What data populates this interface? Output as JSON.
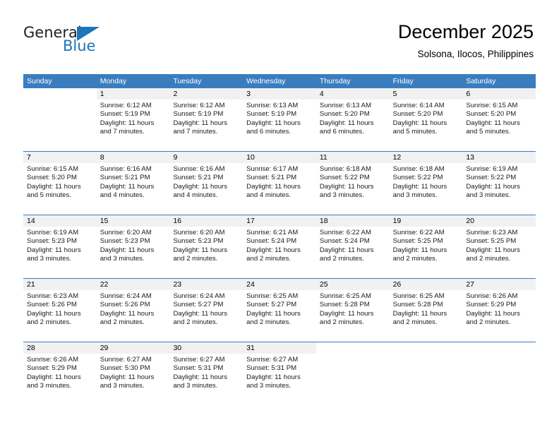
{
  "brand": {
    "name_dark": "General",
    "name_blue": "Blue",
    "accent_color": "#1c76bc"
  },
  "header": {
    "title": "December 2025",
    "subtitle": "Solsona, Ilocos, Philippines"
  },
  "theme": {
    "header_row_color": "#3a7dbf",
    "day_number_band_color": "#f1f1f1",
    "cell_background": "#ffffff",
    "text_color": "#000000"
  },
  "weekdays": [
    "Sunday",
    "Monday",
    "Tuesday",
    "Wednesday",
    "Thursday",
    "Friday",
    "Saturday"
  ],
  "weeks": [
    [
      {
        "day": "",
        "sunrise": "",
        "sunset": "",
        "daylight_line1": "",
        "daylight_line2": ""
      },
      {
        "day": "1",
        "sunrise": "Sunrise: 6:12 AM",
        "sunset": "Sunset: 5:19 PM",
        "daylight_line1": "Daylight: 11 hours",
        "daylight_line2": "and 7 minutes."
      },
      {
        "day": "2",
        "sunrise": "Sunrise: 6:12 AM",
        "sunset": "Sunset: 5:19 PM",
        "daylight_line1": "Daylight: 11 hours",
        "daylight_line2": "and 7 minutes."
      },
      {
        "day": "3",
        "sunrise": "Sunrise: 6:13 AM",
        "sunset": "Sunset: 5:19 PM",
        "daylight_line1": "Daylight: 11 hours",
        "daylight_line2": "and 6 minutes."
      },
      {
        "day": "4",
        "sunrise": "Sunrise: 6:13 AM",
        "sunset": "Sunset: 5:20 PM",
        "daylight_line1": "Daylight: 11 hours",
        "daylight_line2": "and 6 minutes."
      },
      {
        "day": "5",
        "sunrise": "Sunrise: 6:14 AM",
        "sunset": "Sunset: 5:20 PM",
        "daylight_line1": "Daylight: 11 hours",
        "daylight_line2": "and 5 minutes."
      },
      {
        "day": "6",
        "sunrise": "Sunrise: 6:15 AM",
        "sunset": "Sunset: 5:20 PM",
        "daylight_line1": "Daylight: 11 hours",
        "daylight_line2": "and 5 minutes."
      }
    ],
    [
      {
        "day": "7",
        "sunrise": "Sunrise: 6:15 AM",
        "sunset": "Sunset: 5:20 PM",
        "daylight_line1": "Daylight: 11 hours",
        "daylight_line2": "and 5 minutes."
      },
      {
        "day": "8",
        "sunrise": "Sunrise: 6:16 AM",
        "sunset": "Sunset: 5:21 PM",
        "daylight_line1": "Daylight: 11 hours",
        "daylight_line2": "and 4 minutes."
      },
      {
        "day": "9",
        "sunrise": "Sunrise: 6:16 AM",
        "sunset": "Sunset: 5:21 PM",
        "daylight_line1": "Daylight: 11 hours",
        "daylight_line2": "and 4 minutes."
      },
      {
        "day": "10",
        "sunrise": "Sunrise: 6:17 AM",
        "sunset": "Sunset: 5:21 PM",
        "daylight_line1": "Daylight: 11 hours",
        "daylight_line2": "and 4 minutes."
      },
      {
        "day": "11",
        "sunrise": "Sunrise: 6:18 AM",
        "sunset": "Sunset: 5:22 PM",
        "daylight_line1": "Daylight: 11 hours",
        "daylight_line2": "and 3 minutes."
      },
      {
        "day": "12",
        "sunrise": "Sunrise: 6:18 AM",
        "sunset": "Sunset: 5:22 PM",
        "daylight_line1": "Daylight: 11 hours",
        "daylight_line2": "and 3 minutes."
      },
      {
        "day": "13",
        "sunrise": "Sunrise: 6:19 AM",
        "sunset": "Sunset: 5:22 PM",
        "daylight_line1": "Daylight: 11 hours",
        "daylight_line2": "and 3 minutes."
      }
    ],
    [
      {
        "day": "14",
        "sunrise": "Sunrise: 6:19 AM",
        "sunset": "Sunset: 5:23 PM",
        "daylight_line1": "Daylight: 11 hours",
        "daylight_line2": "and 3 minutes."
      },
      {
        "day": "15",
        "sunrise": "Sunrise: 6:20 AM",
        "sunset": "Sunset: 5:23 PM",
        "daylight_line1": "Daylight: 11 hours",
        "daylight_line2": "and 3 minutes."
      },
      {
        "day": "16",
        "sunrise": "Sunrise: 6:20 AM",
        "sunset": "Sunset: 5:23 PM",
        "daylight_line1": "Daylight: 11 hours",
        "daylight_line2": "and 2 minutes."
      },
      {
        "day": "17",
        "sunrise": "Sunrise: 6:21 AM",
        "sunset": "Sunset: 5:24 PM",
        "daylight_line1": "Daylight: 11 hours",
        "daylight_line2": "and 2 minutes."
      },
      {
        "day": "18",
        "sunrise": "Sunrise: 6:22 AM",
        "sunset": "Sunset: 5:24 PM",
        "daylight_line1": "Daylight: 11 hours",
        "daylight_line2": "and 2 minutes."
      },
      {
        "day": "19",
        "sunrise": "Sunrise: 6:22 AM",
        "sunset": "Sunset: 5:25 PM",
        "daylight_line1": "Daylight: 11 hours",
        "daylight_line2": "and 2 minutes."
      },
      {
        "day": "20",
        "sunrise": "Sunrise: 6:23 AM",
        "sunset": "Sunset: 5:25 PM",
        "daylight_line1": "Daylight: 11 hours",
        "daylight_line2": "and 2 minutes."
      }
    ],
    [
      {
        "day": "21",
        "sunrise": "Sunrise: 6:23 AM",
        "sunset": "Sunset: 5:26 PM",
        "daylight_line1": "Daylight: 11 hours",
        "daylight_line2": "and 2 minutes."
      },
      {
        "day": "22",
        "sunrise": "Sunrise: 6:24 AM",
        "sunset": "Sunset: 5:26 PM",
        "daylight_line1": "Daylight: 11 hours",
        "daylight_line2": "and 2 minutes."
      },
      {
        "day": "23",
        "sunrise": "Sunrise: 6:24 AM",
        "sunset": "Sunset: 5:27 PM",
        "daylight_line1": "Daylight: 11 hours",
        "daylight_line2": "and 2 minutes."
      },
      {
        "day": "24",
        "sunrise": "Sunrise: 6:25 AM",
        "sunset": "Sunset: 5:27 PM",
        "daylight_line1": "Daylight: 11 hours",
        "daylight_line2": "and 2 minutes."
      },
      {
        "day": "25",
        "sunrise": "Sunrise: 6:25 AM",
        "sunset": "Sunset: 5:28 PM",
        "daylight_line1": "Daylight: 11 hours",
        "daylight_line2": "and 2 minutes."
      },
      {
        "day": "26",
        "sunrise": "Sunrise: 6:25 AM",
        "sunset": "Sunset: 5:28 PM",
        "daylight_line1": "Daylight: 11 hours",
        "daylight_line2": "and 2 minutes."
      },
      {
        "day": "27",
        "sunrise": "Sunrise: 6:26 AM",
        "sunset": "Sunset: 5:29 PM",
        "daylight_line1": "Daylight: 11 hours",
        "daylight_line2": "and 2 minutes."
      }
    ],
    [
      {
        "day": "28",
        "sunrise": "Sunrise: 6:26 AM",
        "sunset": "Sunset: 5:29 PM",
        "daylight_line1": "Daylight: 11 hours",
        "daylight_line2": "and 3 minutes."
      },
      {
        "day": "29",
        "sunrise": "Sunrise: 6:27 AM",
        "sunset": "Sunset: 5:30 PM",
        "daylight_line1": "Daylight: 11 hours",
        "daylight_line2": "and 3 minutes."
      },
      {
        "day": "30",
        "sunrise": "Sunrise: 6:27 AM",
        "sunset": "Sunset: 5:31 PM",
        "daylight_line1": "Daylight: 11 hours",
        "daylight_line2": "and 3 minutes."
      },
      {
        "day": "31",
        "sunrise": "Sunrise: 6:27 AM",
        "sunset": "Sunset: 5:31 PM",
        "daylight_line1": "Daylight: 11 hours",
        "daylight_line2": "and 3 minutes."
      },
      {
        "day": "",
        "sunrise": "",
        "sunset": "",
        "daylight_line1": "",
        "daylight_line2": ""
      },
      {
        "day": "",
        "sunrise": "",
        "sunset": "",
        "daylight_line1": "",
        "daylight_line2": ""
      },
      {
        "day": "",
        "sunrise": "",
        "sunset": "",
        "daylight_line1": "",
        "daylight_line2": ""
      }
    ]
  ]
}
